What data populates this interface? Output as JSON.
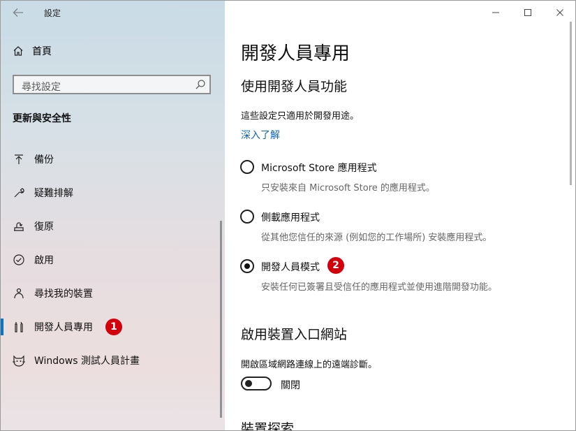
{
  "window": {
    "title": "設定"
  },
  "sidebar": {
    "home_label": "首頁",
    "search_placeholder": "尋找設定",
    "section_title": "更新與安全性",
    "items": [
      {
        "label": "備份",
        "icon": "backup-icon"
      },
      {
        "label": "疑難排解",
        "icon": "wrench-icon"
      },
      {
        "label": "復原",
        "icon": "recovery-icon"
      },
      {
        "label": "啟用",
        "icon": "activation-check-icon"
      },
      {
        "label": "尋找我的裝置",
        "icon": "find-device-icon"
      },
      {
        "label": "開發人員專用",
        "icon": "developer-tools-icon",
        "active": true
      },
      {
        "label": "Windows 測試人員計畫",
        "icon": "insider-cat-icon"
      }
    ],
    "badge_1": "1"
  },
  "main": {
    "title": "開發人員專用",
    "subtitle": "使用開發人員功能",
    "description": "這些設定只適用於開發用途。",
    "learn_more": "深入了解",
    "options": [
      {
        "label": "Microsoft Store 應用程式",
        "help": "只安裝來自 Microsoft Store 的應用程式。",
        "selected": false
      },
      {
        "label": "側載應用程式",
        "help": "從其他您信任的來源 (例如您的工作場所) 安裝應用程式。",
        "selected": false
      },
      {
        "label": "開發人員模式",
        "help": "安裝任何已簽署且受信任的應用程式並使用進階開發功能。",
        "selected": true
      }
    ],
    "badge_2": "2",
    "portal": {
      "title": "啟用裝置入口網站",
      "description": "開啟區域網路連線上的遠端診斷。",
      "toggle_label": "關閉",
      "toggle_on": false
    },
    "discovery_title": "裝置探索"
  },
  "colors": {
    "accent": "#0b74c9",
    "link": "#0a67b3",
    "badge": "#d3000b"
  }
}
